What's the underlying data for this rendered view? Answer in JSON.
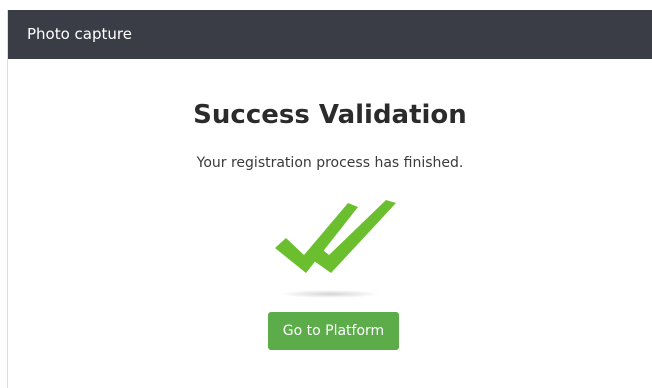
{
  "header": {
    "title": "Photo capture"
  },
  "main": {
    "title": "Success Validation",
    "message": "Your registration process has finished.",
    "icon": "double-check-icon",
    "button_label": "Go to Platform"
  },
  "colors": {
    "header_bg": "#3a3d46",
    "accent_green": "#5cac4a",
    "check_green": "#6bbf2f"
  }
}
